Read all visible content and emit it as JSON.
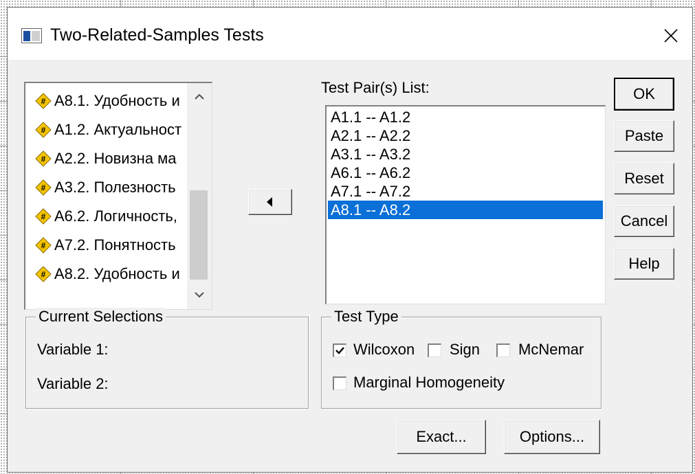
{
  "window": {
    "title": "Two-Related-Samples Tests",
    "close_glyph": "✕"
  },
  "source_variables": [
    {
      "label": "A8.1. Удобность и",
      "icon": "scale-variable-icon"
    },
    {
      "label": "A1.2. Актуальност",
      "icon": "scale-variable-icon"
    },
    {
      "label": "A2.2. Новизна ма",
      "icon": "scale-variable-icon"
    },
    {
      "label": "A3.2. Полезность",
      "icon": "scale-variable-icon"
    },
    {
      "label": "A6.2. Логичность,",
      "icon": "scale-variable-icon"
    },
    {
      "label": "A7.2. Понятность",
      "icon": "scale-variable-icon"
    },
    {
      "label": "A8.2. Удобность и",
      "icon": "scale-variable-icon"
    }
  ],
  "test_pairs": {
    "label": "Test Pair(s) List:",
    "items": [
      "A1.1 -- A1.2",
      "A2.1 -- A2.2",
      "A3.1 -- A3.2",
      "A6.1 -- A6.2",
      "A7.1 -- A7.2",
      "A8.1 -- A8.2"
    ],
    "selected_index": 5
  },
  "buttons": {
    "ok": "OK",
    "paste": "Paste",
    "reset": "Reset",
    "cancel": "Cancel",
    "help": "Help",
    "exact": "Exact...",
    "options": "Options..."
  },
  "current_selections": {
    "title": "Current Selections",
    "variable1": "Variable 1:",
    "variable2": "Variable 2:"
  },
  "test_type": {
    "title": "Test Type",
    "wilcoxon": {
      "label": "Wilcoxon",
      "checked": true
    },
    "sign": {
      "label": "Sign",
      "checked": false
    },
    "mcnemar": {
      "label": "McNemar",
      "checked": false
    },
    "marginal": {
      "label": "Marginal Homogeneity",
      "checked": false
    }
  },
  "colors": {
    "selection": "#0a6fd6",
    "dialog_bg": "#f0f0f0",
    "variable_icon": "#f5c400"
  }
}
